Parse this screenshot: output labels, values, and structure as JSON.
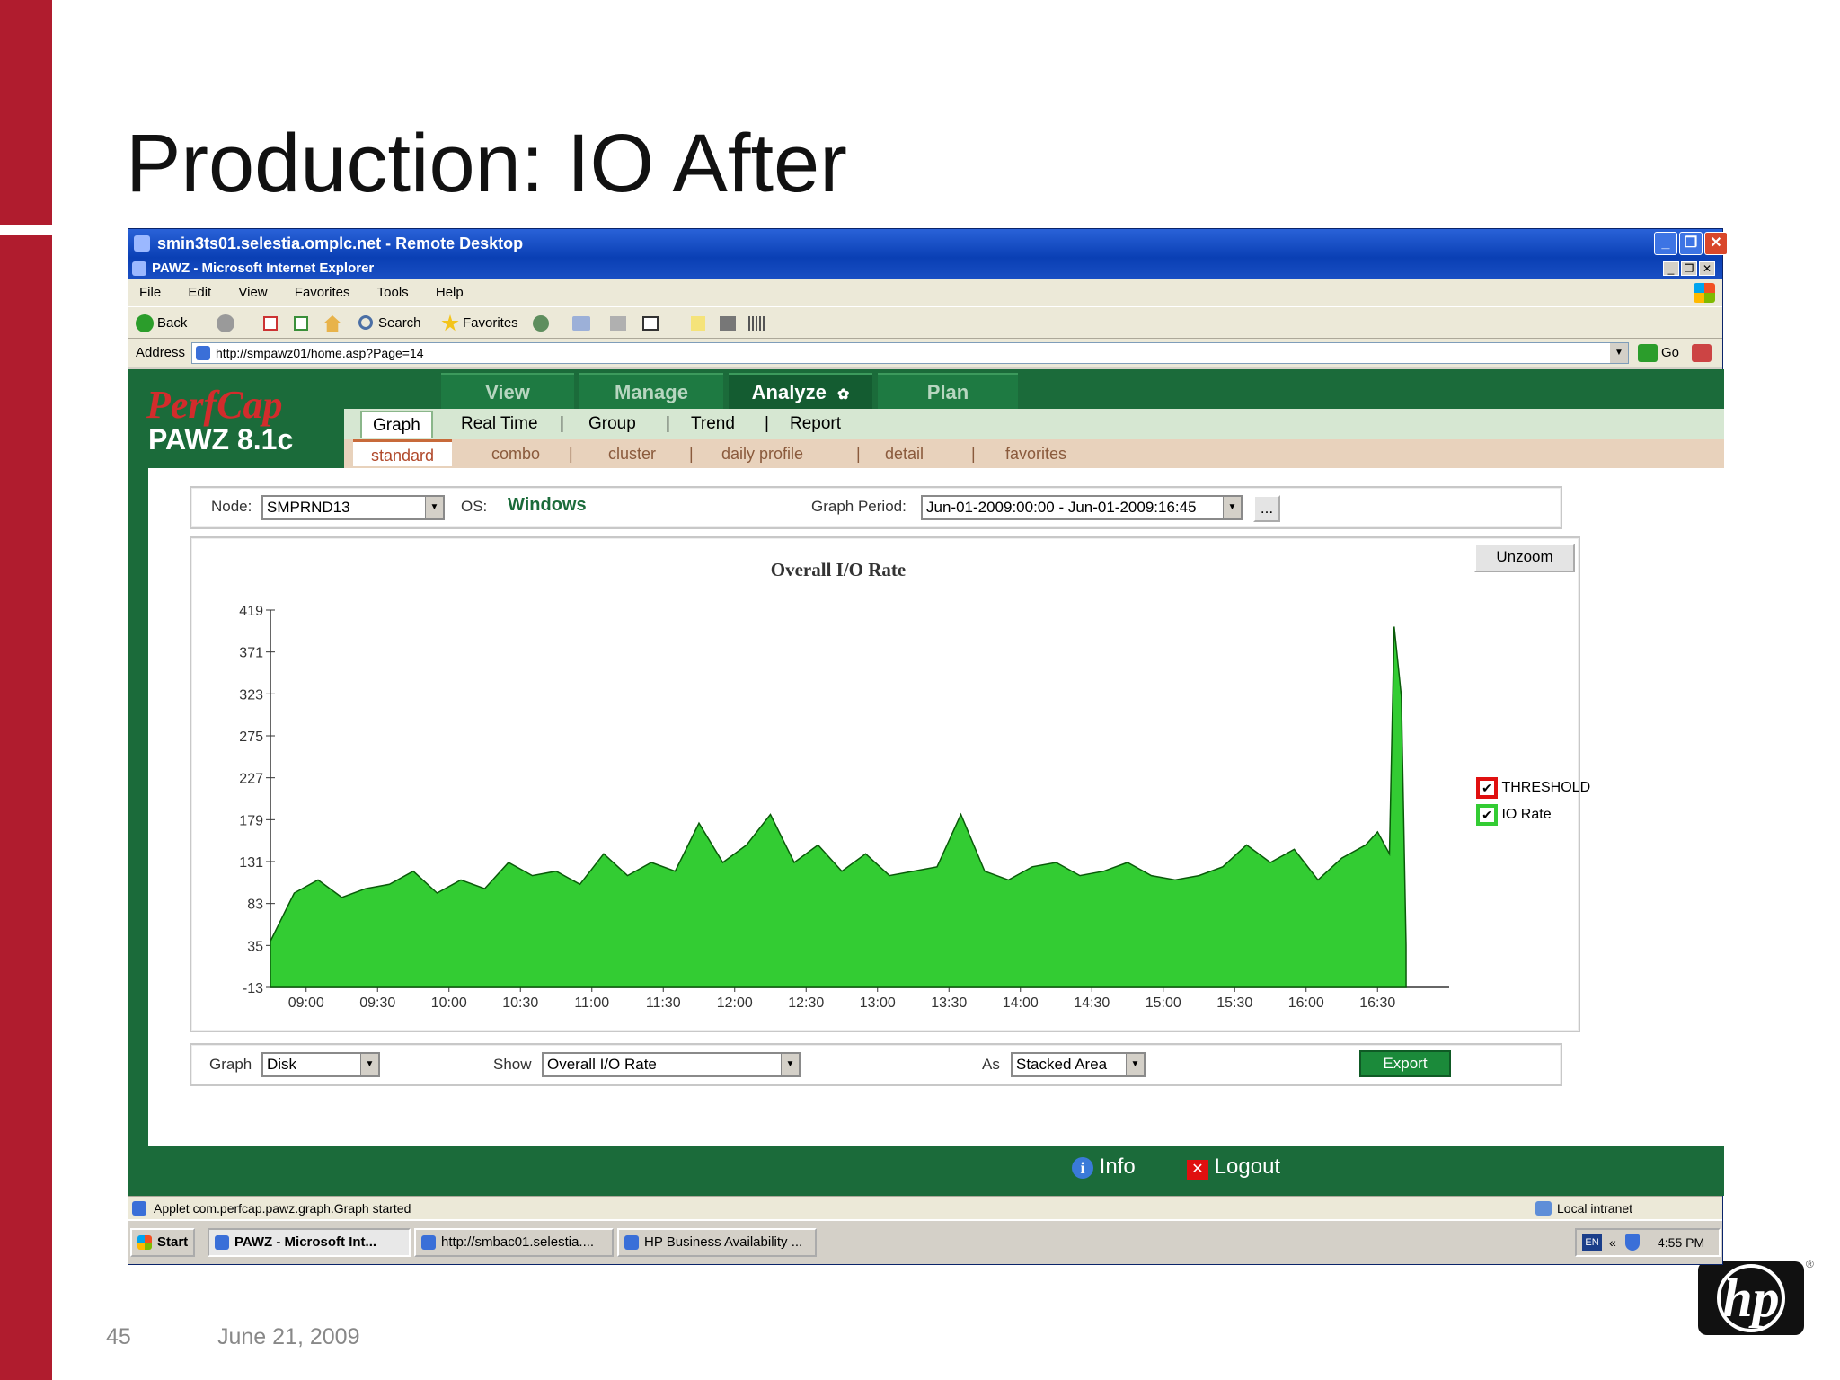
{
  "slide": {
    "title": "Production: IO After",
    "number": "45",
    "date": "June 21, 2009",
    "logo_text": "hp",
    "logo_mark": "®"
  },
  "window": {
    "rd_title": "smin3ts01.selestia.omplc.net - Remote Desktop",
    "ie_title": "PAWZ - Microsoft Internet Explorer"
  },
  "menu": [
    "File",
    "Edit",
    "View",
    "Favorites",
    "Tools",
    "Help"
  ],
  "toolbar": {
    "back": "Back",
    "search": "Search",
    "favorites": "Favorites"
  },
  "address": {
    "label": "Address",
    "url": "http://smpawz01/home.asp?Page=14",
    "go": "Go"
  },
  "app": {
    "logo_brand": "PerfCap",
    "logo_product": "PAWZ 8.1c",
    "nav": [
      "View",
      "Manage",
      "Analyze",
      "Plan"
    ],
    "active_nav": "Analyze",
    "subnav": [
      "Graph",
      "Real Time",
      "Group",
      "Trend",
      "Report"
    ],
    "subnav2": [
      "standard",
      "combo",
      "cluster",
      "daily profile",
      "detail",
      "favorites"
    ],
    "sep": "|"
  },
  "filters": {
    "node_label": "Node:",
    "node_value": "SMPRND13",
    "os_label": "OS:",
    "os_value": "Windows",
    "period_label": "Graph Period:",
    "period_value": "Jun-01-2009:00:00 - Jun-01-2009:16:45",
    "period_btn": "..."
  },
  "chart_controls": {
    "unzoom": "Unzoom"
  },
  "legend": [
    "THRESHOLD",
    "IO Rate"
  ],
  "colors": {
    "area_fill": "#33cc33",
    "area_stroke": "#0a5a0a",
    "threshold": "#e01010",
    "io_rate": "#33cc33"
  },
  "chart_data": {
    "type": "area",
    "title": "Overall I/O Rate",
    "y_ticks": [
      419,
      371,
      323,
      275,
      227,
      179,
      131,
      83,
      35,
      -13
    ],
    "ylim": [
      -13,
      419
    ],
    "x_ticks": [
      "09:00",
      "09:30",
      "10:00",
      "10:30",
      "11:00",
      "11:30",
      "12:00",
      "12:30",
      "13:00",
      "13:30",
      "14:00",
      "14:30",
      "15:00",
      "15:30",
      "16:00",
      "16:30"
    ],
    "x_start": "08:45",
    "x_end": "16:45",
    "series": [
      {
        "name": "IO Rate",
        "x": [
          "08:45",
          "08:55",
          "09:05",
          "09:15",
          "09:25",
          "09:35",
          "09:45",
          "09:55",
          "10:05",
          "10:15",
          "10:25",
          "10:35",
          "10:45",
          "10:55",
          "11:05",
          "11:15",
          "11:25",
          "11:35",
          "11:45",
          "11:55",
          "12:05",
          "12:15",
          "12:25",
          "12:35",
          "12:45",
          "12:55",
          "13:05",
          "13:15",
          "13:25",
          "13:35",
          "13:45",
          "13:55",
          "14:05",
          "14:15",
          "14:25",
          "14:35",
          "14:45",
          "14:55",
          "15:05",
          "15:15",
          "15:25",
          "15:35",
          "15:45",
          "15:55",
          "16:05",
          "16:15",
          "16:25",
          "16:30",
          "16:35",
          "16:37",
          "16:40",
          "16:42"
        ],
        "values": [
          40,
          95,
          110,
          90,
          100,
          105,
          120,
          95,
          110,
          100,
          130,
          115,
          120,
          105,
          140,
          115,
          130,
          120,
          175,
          130,
          150,
          185,
          130,
          150,
          120,
          140,
          115,
          120,
          125,
          185,
          120,
          110,
          125,
          130,
          115,
          120,
          130,
          115,
          110,
          115,
          125,
          150,
          130,
          145,
          110,
          135,
          150,
          165,
          140,
          400,
          320,
          35
        ]
      }
    ]
  },
  "bottom": {
    "graph_label": "Graph",
    "graph_value": "Disk",
    "show_label": "Show",
    "show_value": "Overall I/O Rate",
    "as_label": "As",
    "as_value": "Stacked Area",
    "export": "Export"
  },
  "footer": {
    "info": "Info",
    "logout": "Logout"
  },
  "status": {
    "text": "Applet com.perfcap.pawz.graph.Graph started",
    "zone": "Local intranet"
  },
  "taskbar": {
    "start": "Start",
    "tasks": [
      "PAWZ - Microsoft Int...",
      "http://smbac01.selestia....",
      "HP Business Availability ..."
    ],
    "lang": "EN",
    "clock": "4:55 PM"
  }
}
